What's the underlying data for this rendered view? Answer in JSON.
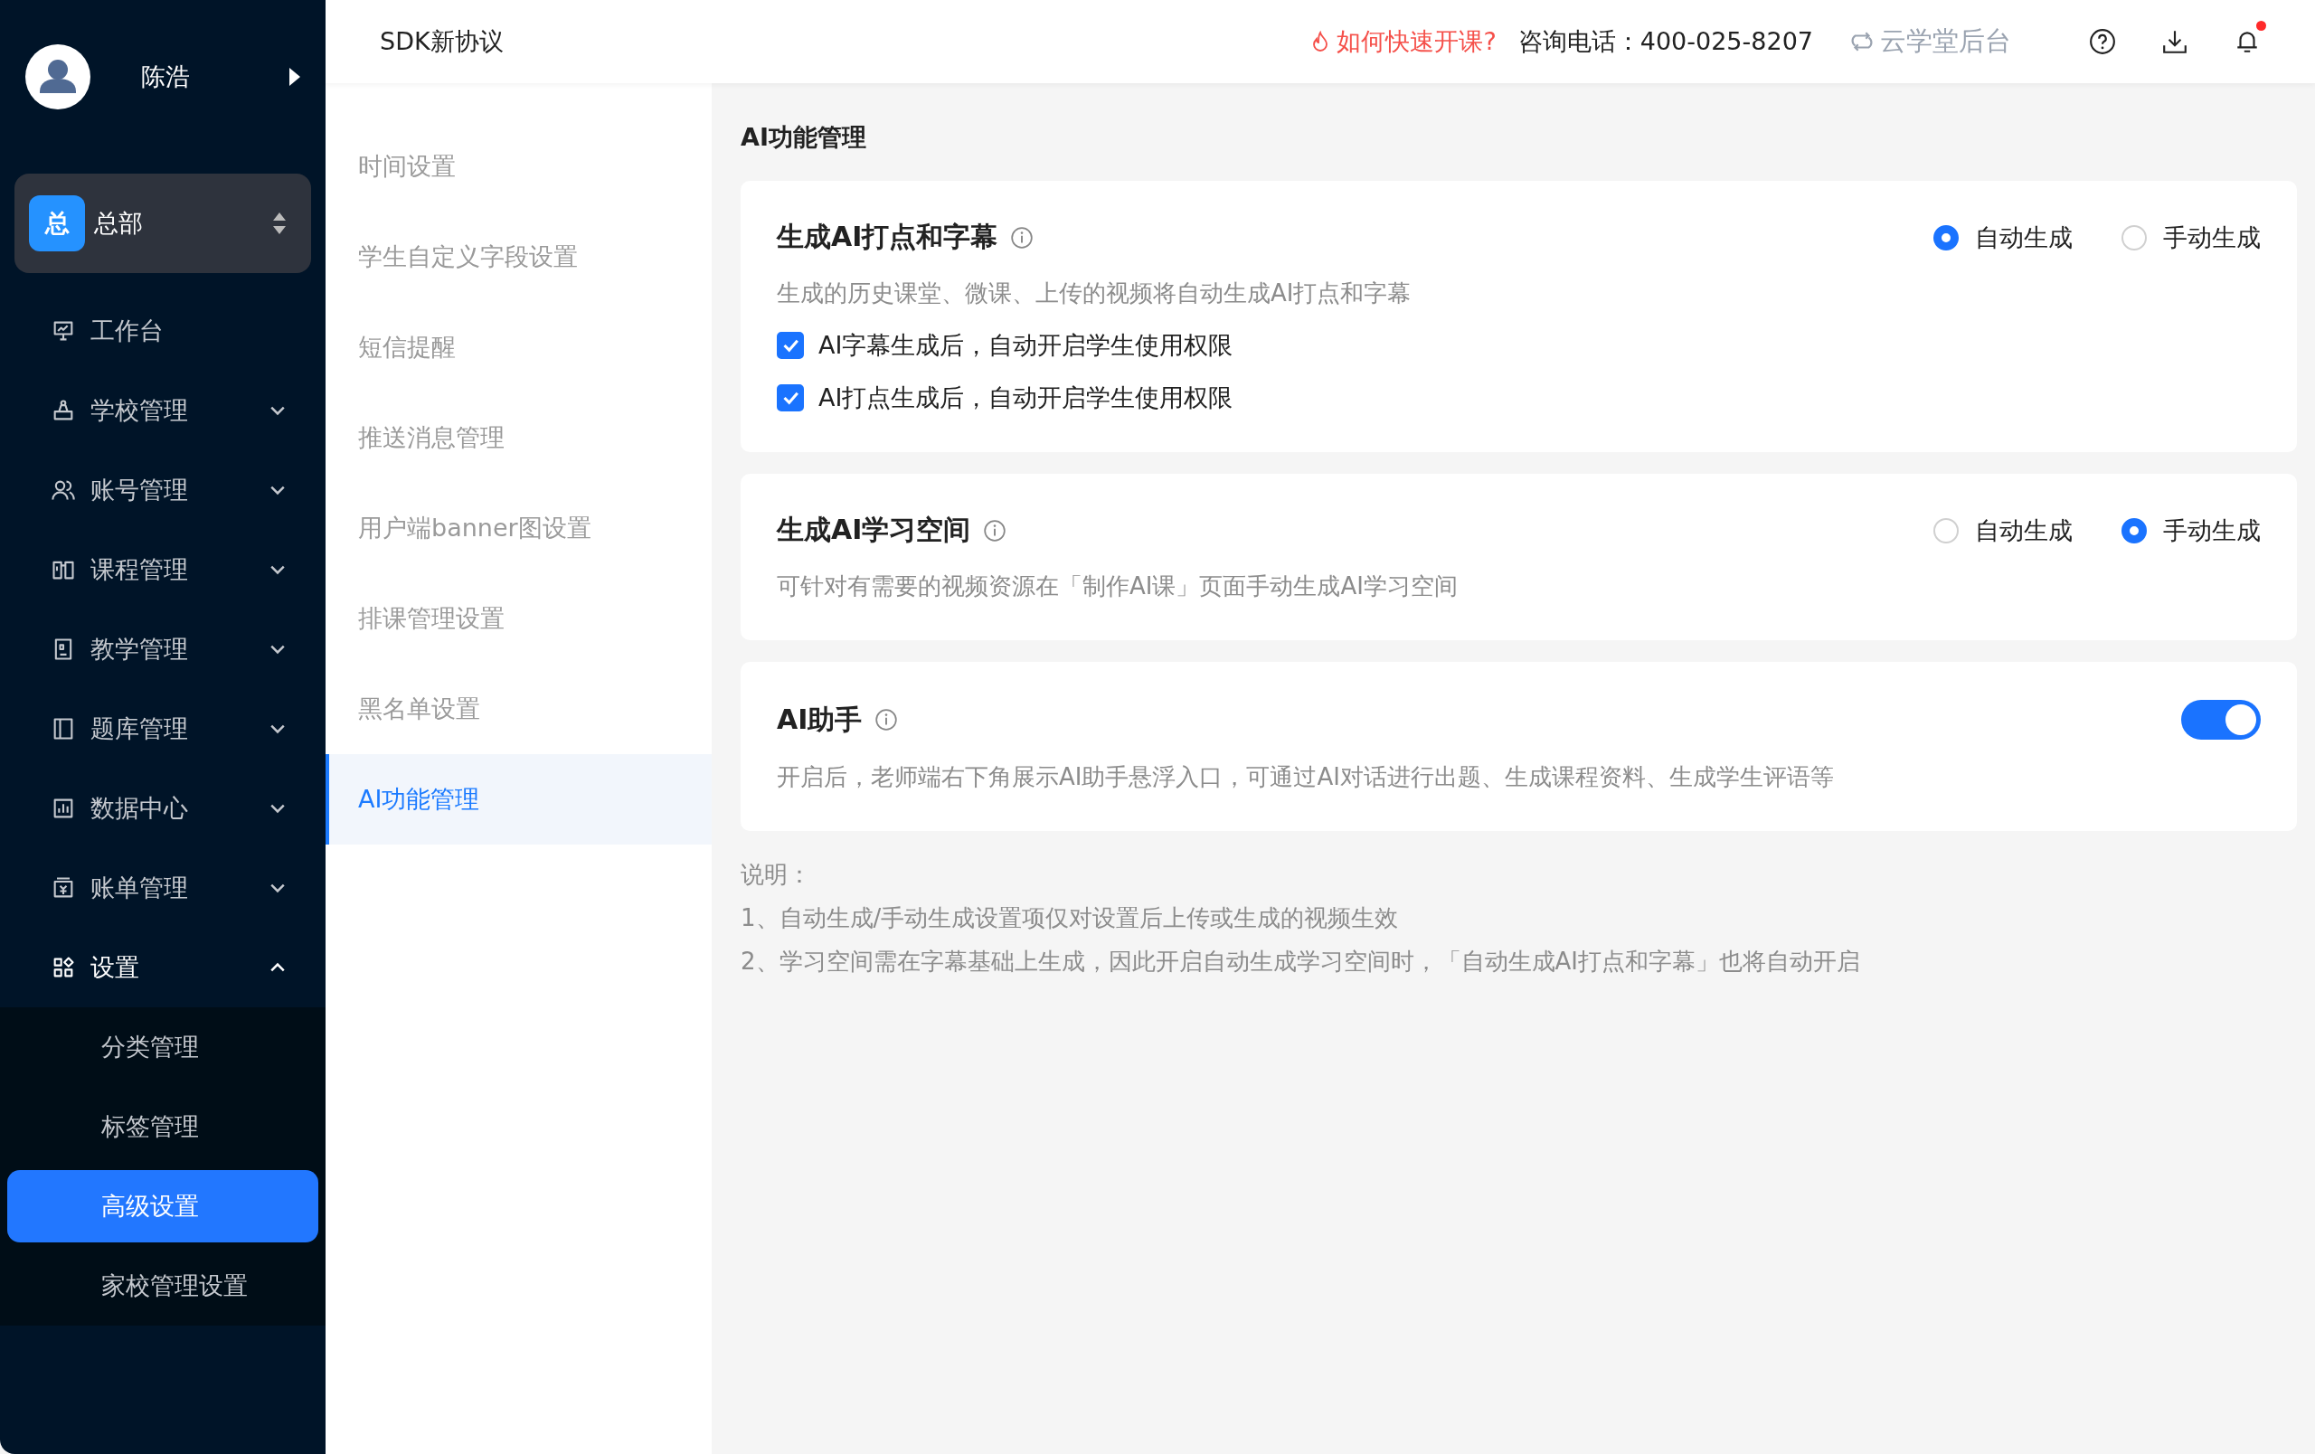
{
  "sidebar": {
    "user": {
      "name": "陈浩"
    },
    "org": {
      "badge": "总",
      "name": "总部"
    },
    "menu": [
      {
        "label": "工作台"
      },
      {
        "label": "学校管理",
        "expanded": false
      },
      {
        "label": "账号管理",
        "expanded": false
      },
      {
        "label": "课程管理",
        "expanded": false
      },
      {
        "label": "教学管理",
        "expanded": false
      },
      {
        "label": "题库管理",
        "expanded": false
      },
      {
        "label": "数据中心",
        "expanded": false
      },
      {
        "label": "账单管理",
        "expanded": false
      },
      {
        "label": "设置",
        "expanded": true,
        "children": [
          {
            "label": "分类管理",
            "selected": false
          },
          {
            "label": "标签管理",
            "selected": false
          },
          {
            "label": "高级设置",
            "selected": true
          },
          {
            "label": "家校管理设置",
            "selected": false
          }
        ]
      }
    ]
  },
  "top_bar": {
    "title": "SDK新协议",
    "help_link": "如何快速开课?",
    "phone": "咨询电话：400-025-8207",
    "backend_link": "云学堂后台",
    "notification_dot": true
  },
  "subnav": [
    {
      "label": "时间设置",
      "selected": false
    },
    {
      "label": "学生自定义字段设置",
      "selected": false
    },
    {
      "label": "短信提醒",
      "selected": false
    },
    {
      "label": "推送消息管理",
      "selected": false
    },
    {
      "label": "用户端banner图设置",
      "selected": false
    },
    {
      "label": "排课管理设置",
      "selected": false
    },
    {
      "label": "黑名单设置",
      "selected": false
    },
    {
      "label": "AI功能管理",
      "selected": true
    }
  ],
  "content": {
    "title": "AI功能管理",
    "sections": [
      {
        "kind": "radio",
        "title": "生成AI打点和字幕",
        "description": "生成的历史课堂、微课、上传的视频将自动生成AI打点和字幕",
        "options": [
          {
            "label": "自动生成",
            "selected": true
          },
          {
            "label": "手动生成",
            "selected": false
          }
        ],
        "checkboxes": [
          {
            "label": "AI字幕生成后，自动开启学生使用权限",
            "checked": true
          },
          {
            "label": "AI打点生成后，自动开启学生使用权限",
            "checked": true
          }
        ]
      },
      {
        "kind": "radio",
        "title": "生成AI学习空间",
        "description": "可针对有需要的视频资源在「制作AI课」页面手动生成AI学习空间",
        "options": [
          {
            "label": "自动生成",
            "selected": false
          },
          {
            "label": "手动生成",
            "selected": true
          }
        ]
      },
      {
        "kind": "toggle",
        "title": "AI助手",
        "description": "开启后，老师端右下角展示AI助手悬浮入口，可通过AI对话进行出题、生成课程资料、生成学生评语等",
        "on": true
      }
    ],
    "notes": [
      "说明：",
      "1、自动生成/手动生成设置项仅对设置后上传或生成的视频生效",
      "2、学习空间需在字幕基础上生成，因此开启自动生成学习空间时，「自动生成AI打点和字幕」也将自动开启"
    ]
  }
}
